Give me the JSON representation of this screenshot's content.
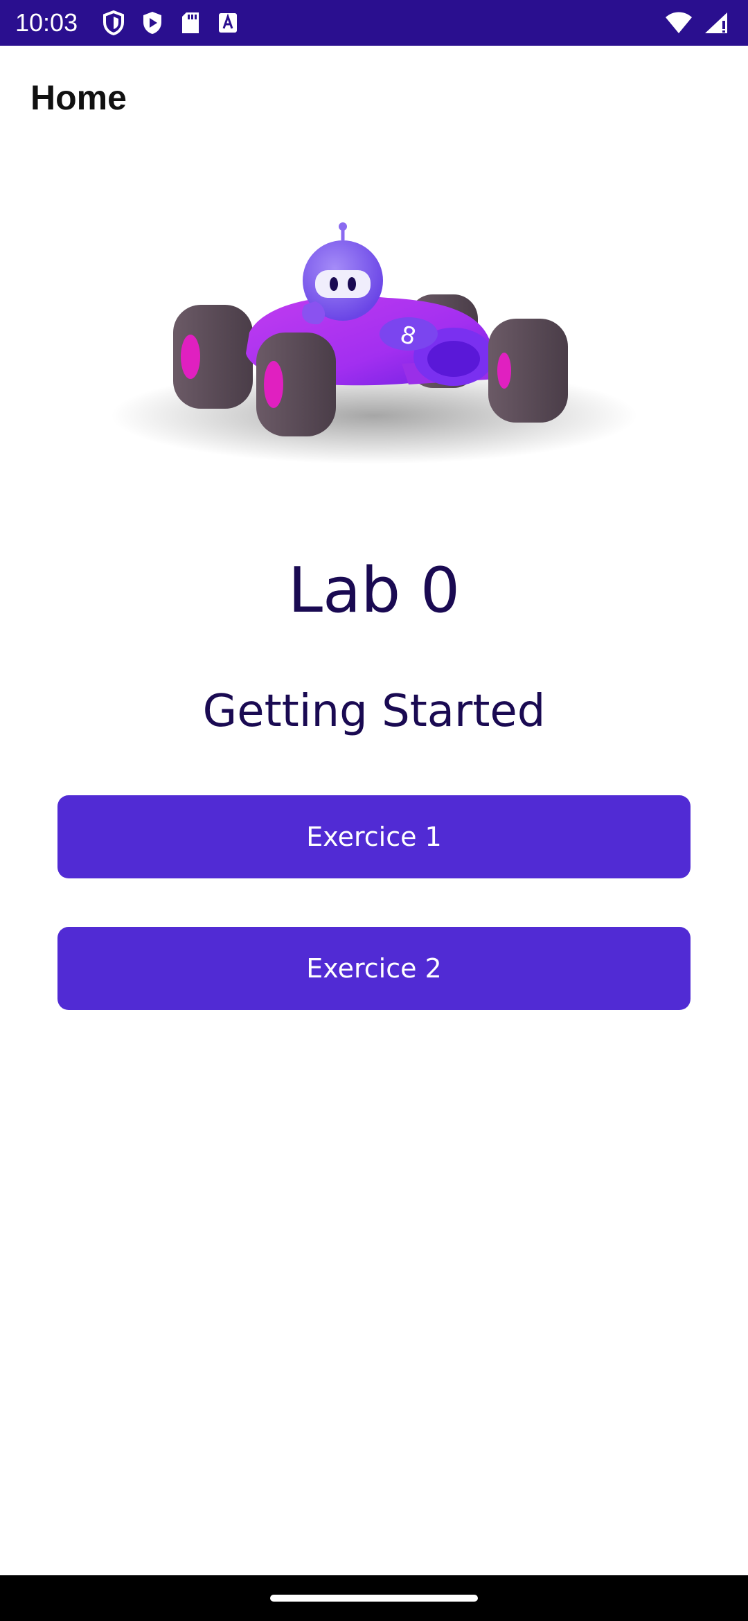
{
  "status_bar": {
    "time": "10:03",
    "background": "#2a0f8f",
    "icons_left": [
      "shield-icon",
      "play-store-icon",
      "sd-card-icon",
      "font-a-icon"
    ],
    "icons_right": [
      "wifi-icon",
      "signal-icon"
    ]
  },
  "app_bar": {
    "title": "Home"
  },
  "hero": {
    "image": "race-car-bot-illustration"
  },
  "main": {
    "title": "Lab 0",
    "subtitle": "Getting Started",
    "buttons": [
      {
        "label": "Exercice 1"
      },
      {
        "label": "Exercice 2"
      }
    ],
    "accent_color": "#512bd4",
    "text_color": "#1a0a52"
  },
  "nav_bar": {
    "handle": "home-gesture-handle"
  }
}
